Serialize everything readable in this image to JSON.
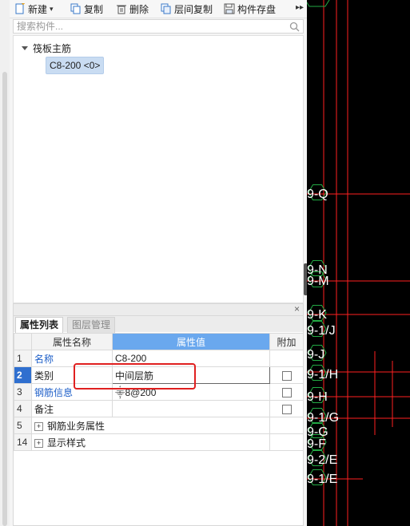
{
  "toolbar": {
    "items": [
      {
        "label": "新建",
        "icon": "new-document-icon",
        "has_dropdown": true
      },
      {
        "label": "复制",
        "icon": "copy-icon"
      },
      {
        "label": "删除",
        "icon": "delete-icon"
      },
      {
        "label": "层间复制",
        "icon": "floor-copy-icon"
      },
      {
        "label": "构件存盘",
        "icon": "component-save-icon"
      }
    ],
    "more_icon": "overflow-arrows-icon"
  },
  "search": {
    "placeholder": "搜索构件..."
  },
  "tree": {
    "root_label": "筏板主筋",
    "selected_item": "C8-200 <0>"
  },
  "properties_panel": {
    "close_glyph": "×",
    "tabs": [
      {
        "label": "属性列表",
        "active": true
      },
      {
        "label": "图层管理",
        "active": false
      }
    ],
    "columns": [
      "属性名称",
      "属性值",
      "附加"
    ],
    "rows": [
      {
        "num": "1",
        "name": "名称",
        "value": "C8-200",
        "link": true,
        "has_checkbox": false,
        "checked": false
      },
      {
        "num": "2",
        "name": "类别",
        "value": "中间层筋",
        "link": false,
        "has_checkbox": true,
        "checked": false,
        "selected": true,
        "editing": true
      },
      {
        "num": "3",
        "name": "钢筋信息",
        "value": "⸎8@200",
        "link": true,
        "has_checkbox": true,
        "checked": false
      },
      {
        "num": "4",
        "name": "备注",
        "value": "",
        "link": false,
        "has_checkbox": true,
        "checked": false
      },
      {
        "num": "5",
        "name": "钢筋业务属性",
        "value": "",
        "link": false,
        "has_checkbox": false,
        "expander": "+"
      },
      {
        "num": "14",
        "name": "显示样式",
        "value": "",
        "link": false,
        "has_checkbox": false,
        "expander": "+"
      }
    ]
  },
  "canvas": {
    "background": "#000000",
    "axis_color": "#ff2020",
    "label_color": "#ffffff",
    "node_color": "#22aa44",
    "axis_labels": [
      "9-Q",
      "9-N",
      "9-M",
      "9-K",
      "9-1/J",
      "9-J",
      "9-1/H",
      "9-H",
      "9-1/G",
      "9-G",
      "9-F",
      "9-2/E",
      "9-1/E"
    ]
  },
  "colors": {
    "accent": "#6aa8ee",
    "selected_row": "#2f6fcf",
    "callout": "#e02020",
    "link": "#1e5fc8"
  }
}
